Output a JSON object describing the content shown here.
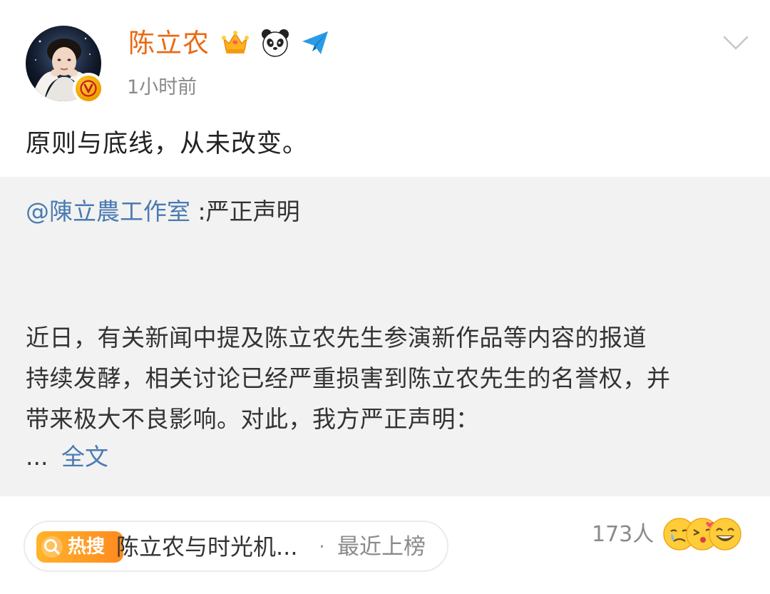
{
  "post": {
    "author": {
      "name": "陈立农",
      "avatar_icon": "user-avatar",
      "verified_icon": "verified-v-icon",
      "badges": [
        "crown-badge-icon",
        "panda-icon",
        "send-plane-icon"
      ]
    },
    "time": "1小时前",
    "text": "原则与底线，从未改变。",
    "menu_icon": "chevron-down-icon"
  },
  "retweet": {
    "mention": "@陳立農工作室",
    "title": ":严正声明",
    "body_lines": [
      "近日，有关新闻中提及陈立农先生参演新作品等内容的报道",
      "持续发酵，相关讨论已经严重损害到陈立农先生的名誉权，并",
      "带来极大不良影响。对此，我方严正声明："
    ],
    "ellipsis": "...",
    "full_text_label": "全文"
  },
  "footer": {
    "hot_search": {
      "badge_label": "热搜",
      "topic": "陈立农与时光机...",
      "separator": "·",
      "status": "最近上榜"
    },
    "reactions": {
      "count": "173人",
      "emojis": [
        "crying-face-icon",
        "kissing-face-icon",
        "grinning-face-icon"
      ]
    }
  },
  "colors": {
    "author_name": "#ea6a12",
    "link": "#4a7bb1",
    "hot_badge": "#ff9a22",
    "retweet_bg": "#f2f2f2"
  }
}
